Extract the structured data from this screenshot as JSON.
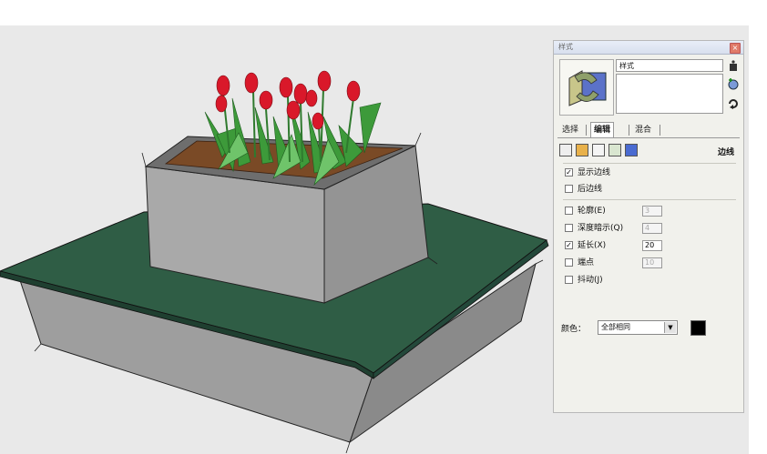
{
  "styles_panel": {
    "title": "样式",
    "style_name": "样式",
    "description": "",
    "tabs": [
      {
        "label": "选择"
      },
      {
        "label": "编辑"
      },
      {
        "label": "混合"
      }
    ],
    "active_tab": "编辑",
    "edges_label": "边线",
    "options": [
      {
        "label": "显示边线",
        "checked": true
      },
      {
        "label": "后边线",
        "checked": false
      },
      {
        "label": "轮廓(E)",
        "checked": false,
        "value": "3"
      },
      {
        "label": "深度暗示(Q)",
        "checked": false,
        "value": "4"
      },
      {
        "label": "延长(X)",
        "checked": true,
        "value": "20"
      },
      {
        "label": "端点",
        "checked": false,
        "value": "10"
      },
      {
        "label": "抖动(J)",
        "checked": false
      }
    ],
    "color_label": "颜色：",
    "color_select": "全部相同",
    "color_swatch": "#000000"
  },
  "icons": {
    "close": "close-icon",
    "side": [
      "bucket-icon",
      "create-style-icon",
      "update-style-icon"
    ],
    "faces": [
      "face-style-1-icon",
      "face-style-2-icon",
      "face-style-3-icon",
      "face-style-4-icon",
      "face-style-5-icon"
    ]
  },
  "colors": {
    "viewport": "#e9e9e9",
    "table_top": "#2e5a44",
    "planter": "#a8a8a8",
    "soil": "#7a4a26",
    "tulip": "#d9182a",
    "leaf": "#3d9a3a"
  }
}
